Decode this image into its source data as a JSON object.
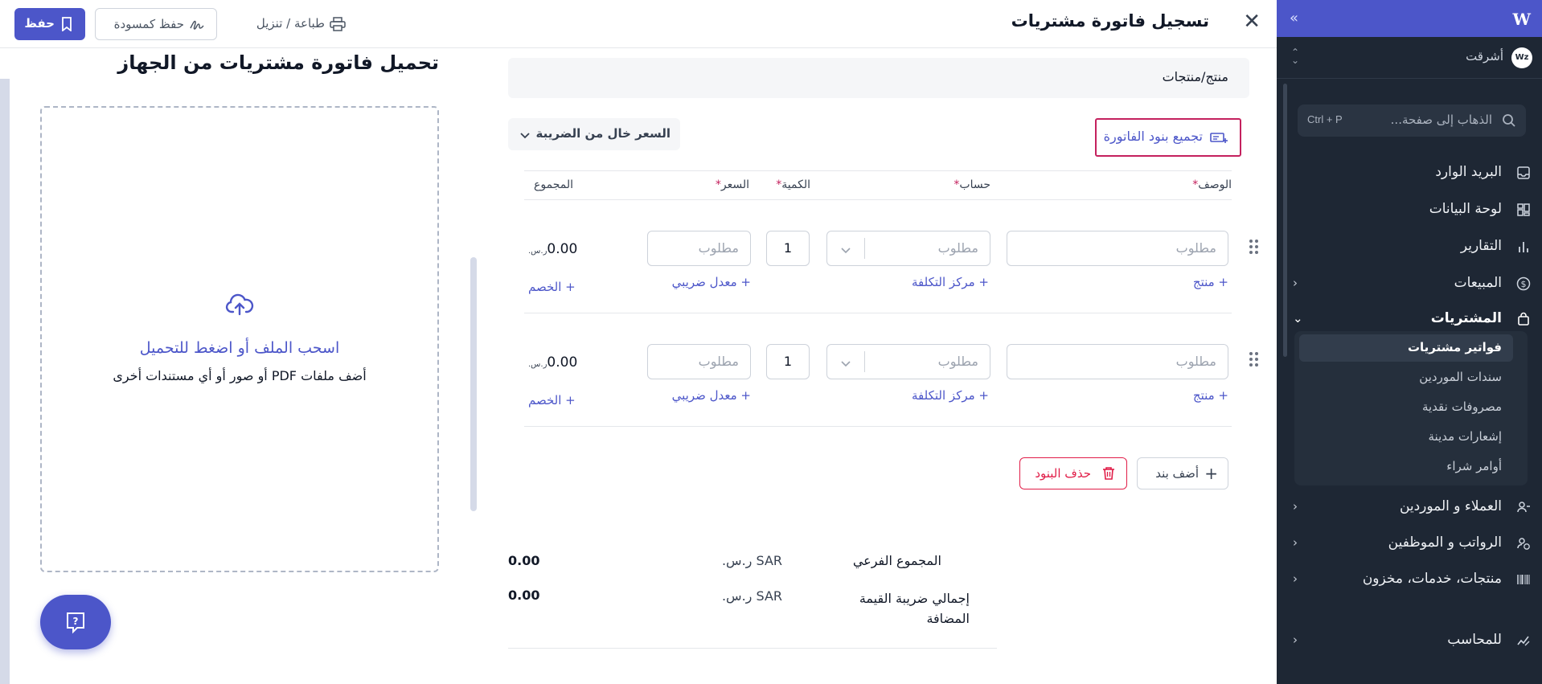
{
  "header": {
    "title": "تسجيل فاتورة مشتريات",
    "save_label": "حفظ",
    "draft_label": "حفظ كمسودة",
    "print_label": "طباعة / تنزيل"
  },
  "sidebar": {
    "org_name": "أشرقت",
    "org_avatar_text": "Wz",
    "search": {
      "placeholder": "الذهاب إلى صفحة...",
      "shortcut": "Ctrl + P"
    },
    "items": [
      {
        "label": "البريد الوارد",
        "icon": "inbox-icon"
      },
      {
        "label": "لوحة البيانات",
        "icon": "dashboard-icon"
      },
      {
        "label": "التقارير",
        "icon": "chart-icon"
      },
      {
        "label": "المبيعات",
        "icon": "dollar-icon"
      },
      {
        "label": "المشتريات",
        "icon": "shopping-bag-icon"
      },
      {
        "label": "العملاء و الموردين",
        "icon": "users-icon"
      },
      {
        "label": "الرواتب و الموظفين",
        "icon": "payroll-icon"
      },
      {
        "label": "منتجات، خدمات، مخزون",
        "icon": "barcode-icon"
      },
      {
        "label": "للمحاسب",
        "icon": "accountant-icon"
      }
    ],
    "purchases_sub": [
      "فواتير مشتريات",
      "سندات الموردين",
      "مصروفات نقدية",
      "إشعارات مدينة",
      "أوامر شراء"
    ]
  },
  "upload": {
    "title": "تحميل فاتورة مشتريات من الجهاز",
    "drop_main": "اسحب الملف أو اضغط للتحميل",
    "drop_sub": "أضف ملفات PDF أو صور أو أي مستندات أخرى"
  },
  "form": {
    "section_label": "منتج/منتجات",
    "group_lines_label": "تجميع بنود الفاتورة",
    "tax_mode": "السعر خال من الضريبة",
    "columns": {
      "description": "الوصف",
      "account": "حساب",
      "quantity": "الكمية",
      "price": "السعر",
      "total": "المجموع"
    },
    "required_mark": "*",
    "placeholder_required": "مطلوب",
    "lines": [
      {
        "quantity": "1",
        "total": "0.00",
        "currency": "ر.س."
      },
      {
        "quantity": "1",
        "total": "0.00",
        "currency": "ر.س."
      }
    ],
    "links": {
      "product": "+ منتج",
      "cost_center": "+ مركز التكلفة",
      "tax_rate": "+ معدل ضريبي",
      "discount": "+ الخصم"
    },
    "add_line_label": "أضف بند",
    "delete_lines_label": "حذف البنود"
  },
  "totals": [
    {
      "label": "المجموع الفرعي",
      "currency": "SAR ر.س.",
      "value": "0.00"
    },
    {
      "label": "إجمالي ضريبة القيمة المضافة",
      "currency": "SAR ر.س.",
      "value": "0.00"
    }
  ],
  "colors": {
    "primary": "#4c56c9",
    "sidebar_bg": "#1e2734",
    "danger": "#e11d48",
    "highlight_border": "#c4215e"
  }
}
